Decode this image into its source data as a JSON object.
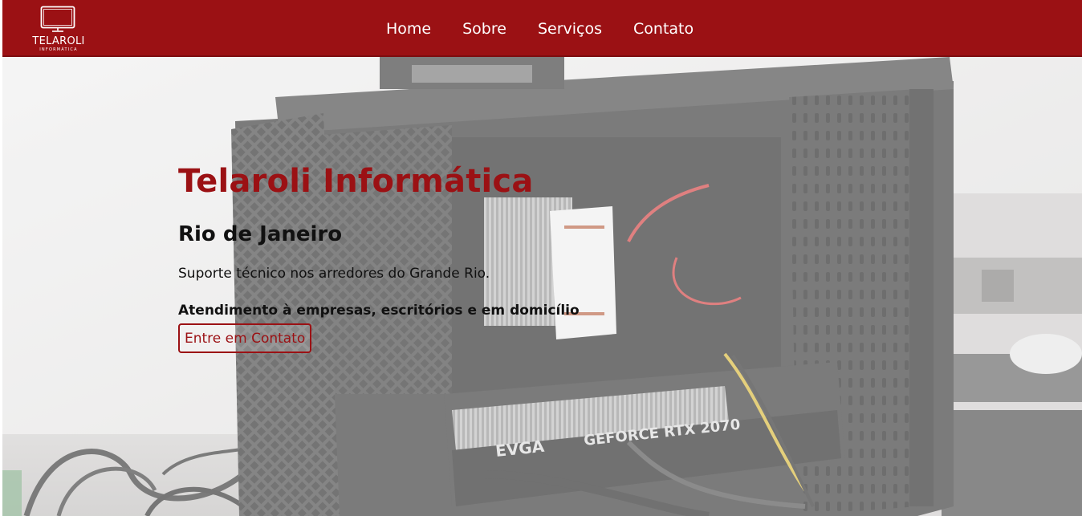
{
  "brand": {
    "logo_text": "TELAROLI",
    "logo_subtext": "INFORMÁTICA",
    "logo_icon": "monitor-icon",
    "color": "#9b1114"
  },
  "nav": {
    "items": [
      {
        "label": "Home"
      },
      {
        "label": "Sobre"
      },
      {
        "label": "Serviços"
      },
      {
        "label": "Contato"
      }
    ]
  },
  "hero": {
    "title": "Telaroli Informática",
    "subtitle": "Rio de Janeiro",
    "description": "Suporte técnico nos arredores do Grande Rio.",
    "highlight": "Atendimento à empresas, escritórios e em domicílio",
    "cta_label": "Entre em Contato",
    "background_image": "pc-case-interior-photo",
    "gpu_brand": "EVGA",
    "gpu_model": "GEFORCE RTX 2070"
  }
}
